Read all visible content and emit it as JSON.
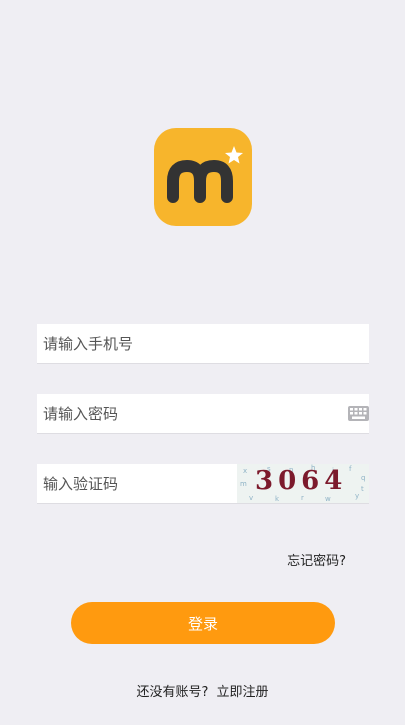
{
  "brand": {
    "logo_bg": "#f7b52c",
    "logo_mark": "#333333",
    "logo_star": "#ffffff"
  },
  "form": {
    "phone_placeholder": "请输入手机号",
    "password_placeholder": "请输入密码",
    "code_placeholder": "输入验证码",
    "captcha_text": "3064"
  },
  "links": {
    "forgot": "忘记密码?",
    "no_account": "还没有账号?",
    "register": "立即注册"
  },
  "buttons": {
    "login_label": "登录",
    "login_color": "#ff9a0f"
  },
  "icons": {
    "keyboard": "keyboard-icon",
    "logo": "app-logo-icon"
  }
}
